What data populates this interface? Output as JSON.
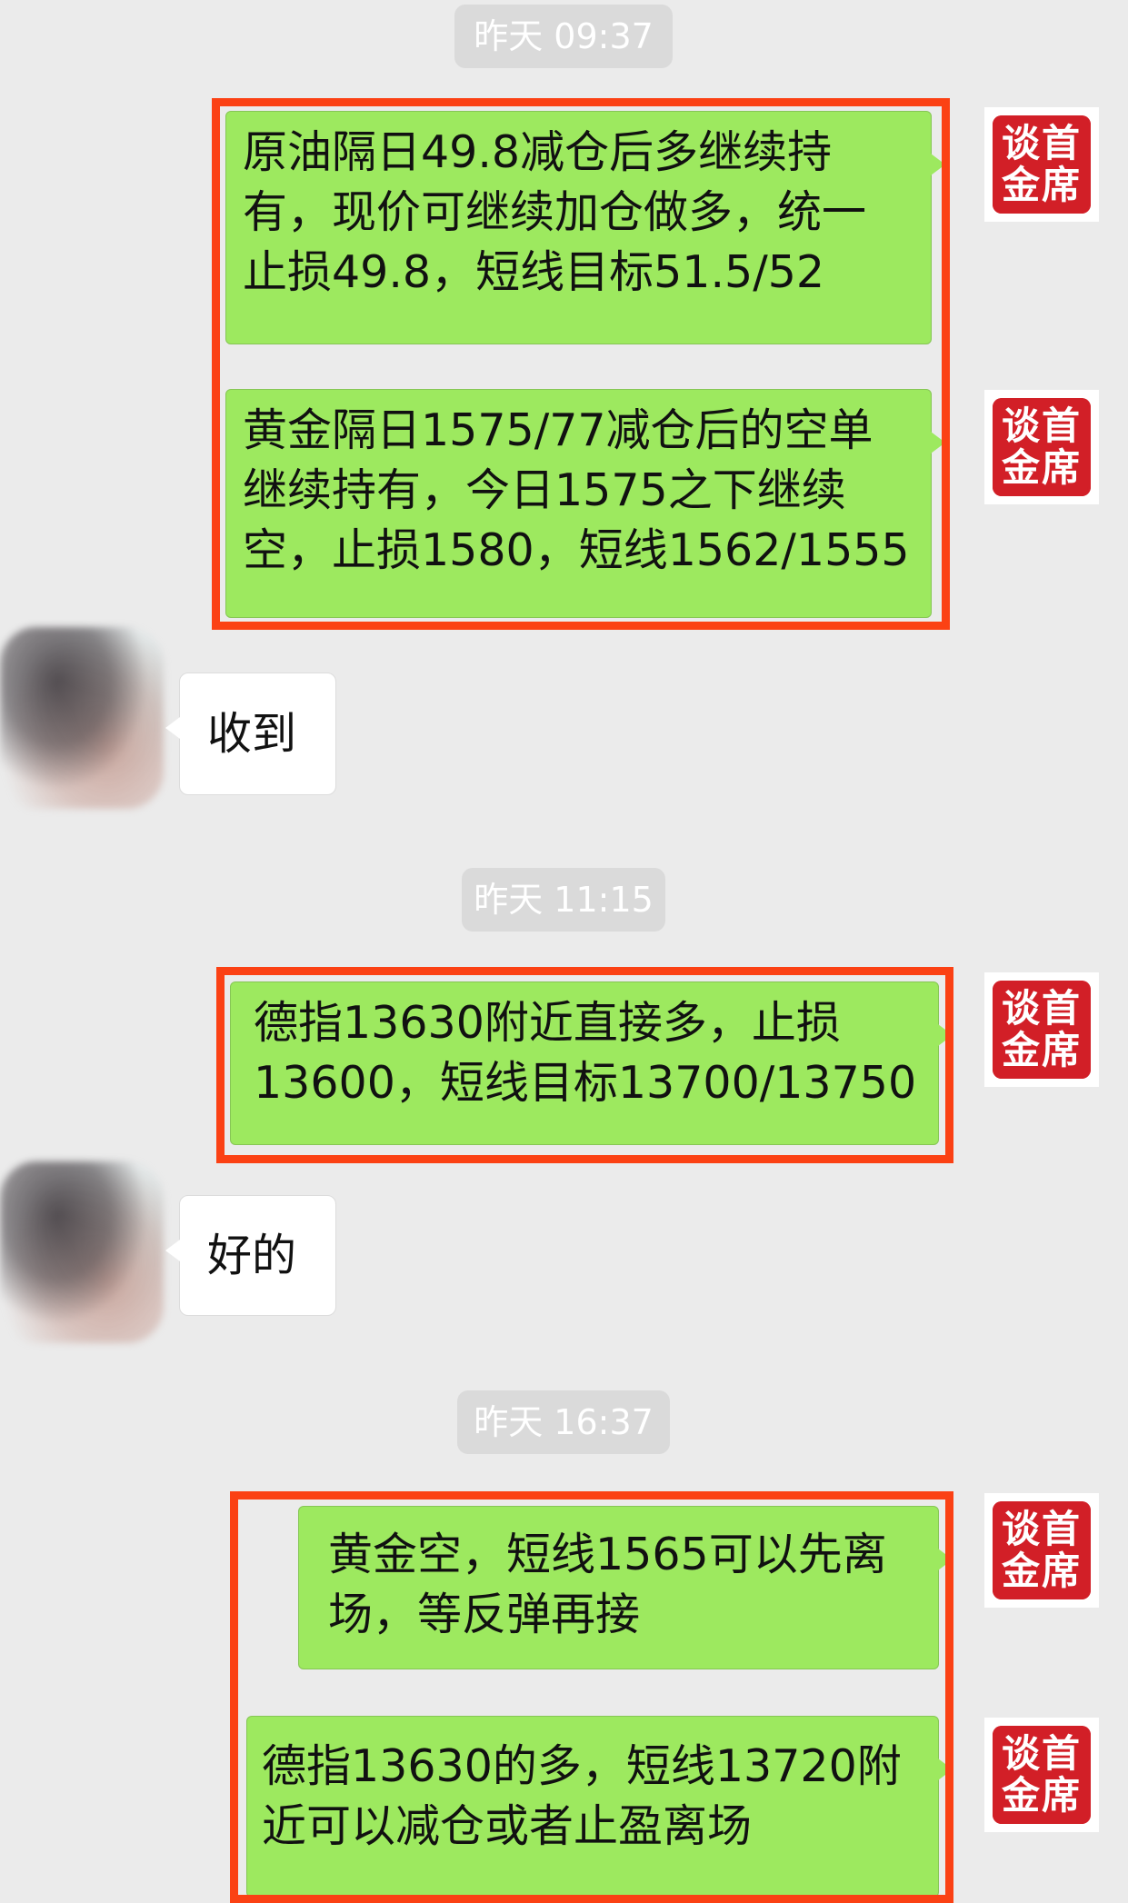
{
  "timestamps": [
    "昨天 09:37",
    "昨天 11:15",
    "昨天 16:37"
  ],
  "sender_avatar_text": "谈首\n金席",
  "messages": [
    {
      "text": "原油隔日49.8减仓后多继续持\n有，现价可继续加仓做多，统一\n止损49.8，短线目标51.5/52"
    },
    {
      "text": "黄金隔日1575/77减仓后的空单\n继续持有，今日1575之下继续\n空，止损1580，短线1562/1555"
    },
    {
      "text": "收到"
    },
    {
      "text": "德指13630附近直接多，止损\n13600，短线目标13700/13750"
    },
    {
      "text": "好的"
    },
    {
      "text": "黄金空，短线1565可以先离\n场，等反弹再接"
    },
    {
      "text": "德指13630的多，短线13720附\n近可以减仓或者止盈离场"
    }
  ],
  "colors": {
    "background": "#ebebeb",
    "outgoing_bubble": "#9de95f",
    "incoming_bubble": "#ffffff",
    "highlight_box": "#fb4114",
    "seal_red": "#d21f27",
    "timestamp_bg": "#dadada"
  }
}
